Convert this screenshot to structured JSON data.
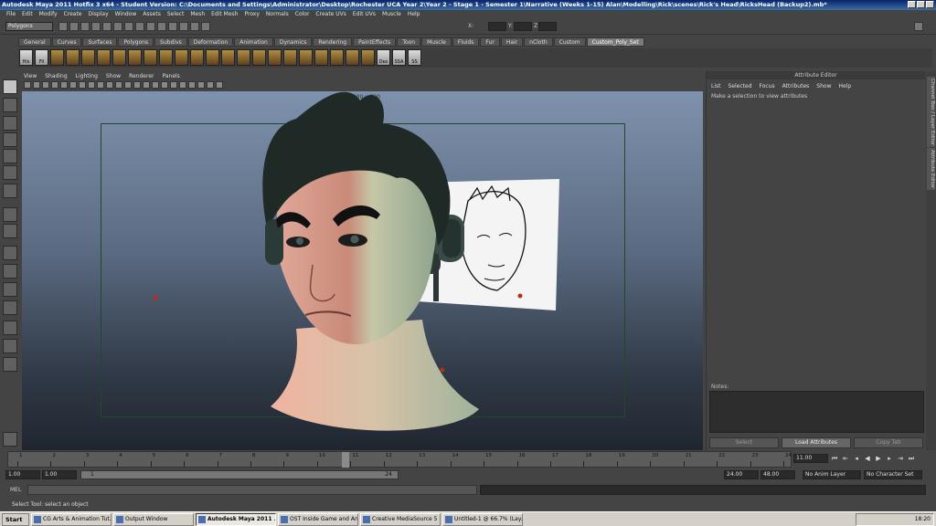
{
  "window": {
    "title": "Autodesk Maya 2011 Hotfix 3 x64 - Student Version: C:\\Documents and Settings\\Administrator\\Desktop\\Rochester UCA Year 2\\Year 2 - Stage 1 - Semester 1\\Narrative (Weeks 1-15) Alan\\Modelling\\Rick\\scenes\\Rick's Head\\RicksHead (Backup2).mb*"
  },
  "menubar": [
    "File",
    "Edit",
    "Modify",
    "Create",
    "Display",
    "Window",
    "Assets",
    "Select",
    "Mesh",
    "Edit Mesh",
    "Proxy",
    "Normals",
    "Color",
    "Create UVs",
    "Edit UVs",
    "Muscle",
    "Help"
  ],
  "statusline": {
    "mode": "Polygons",
    "x_label": "X:",
    "y_label": "Y:",
    "z_label": "Z:"
  },
  "shelf_tabs": [
    "General",
    "Curves",
    "Surfaces",
    "Polygons",
    "Subdivs",
    "Deformation",
    "Animation",
    "Dynamics",
    "Rendering",
    "PaintEffects",
    "Toon",
    "Muscle",
    "Fluids",
    "Fur",
    "Hair",
    "nCloth",
    "Custom",
    "Custom_Poly_Set"
  ],
  "active_shelf_tab": "Custom_Poly_Set",
  "shelf_labels": [
    "His",
    "Fil",
    "Des",
    "SSA",
    "SS"
  ],
  "panel_menu": [
    "View",
    "Shading",
    "Lighting",
    "Show",
    "Renderer",
    "Panels"
  ],
  "viewport": {
    "resolution": "1280 x 720"
  },
  "attribute_editor": {
    "title": "Attribute Editor",
    "menu": [
      "List",
      "Selected",
      "Focus",
      "Attributes",
      "Show",
      "Help"
    ],
    "message": "Make a selection to view attributes",
    "notes_label": "Notes:",
    "buttons": [
      "Select",
      "Load Attributes",
      "Copy Tab"
    ]
  },
  "side_tabs": [
    "Channel Box / Layer Editor",
    "Attribute Editor"
  ],
  "timeline": {
    "ticks": [
      1,
      2,
      3,
      4,
      5,
      6,
      7,
      8,
      9,
      10,
      11,
      12,
      13,
      14,
      15,
      16,
      17,
      18,
      19,
      20,
      21,
      22,
      23,
      24
    ],
    "current_frame": "11",
    "current_field": "11.00"
  },
  "range": {
    "start": "1.00",
    "playback_start": "1.00",
    "slider_start": "1",
    "slider_end": "24",
    "playback_end": "24.00",
    "end": "48.00",
    "anim_layer": "No Anim Layer",
    "character_set": "No Character Set"
  },
  "mel": {
    "label": "MEL"
  },
  "helpline": "Select Tool: select an object",
  "taskbar": {
    "start": "Start",
    "tasks": [
      "CG Arts & Animation Tut...",
      "Output Window",
      "Autodesk Maya 2011 ...",
      "OST Inside Game and An...",
      "Creative MediaSource 5",
      "Untitled-1 @ 66.7% (Lay..."
    ],
    "active_task": 2,
    "time": "18:20"
  }
}
